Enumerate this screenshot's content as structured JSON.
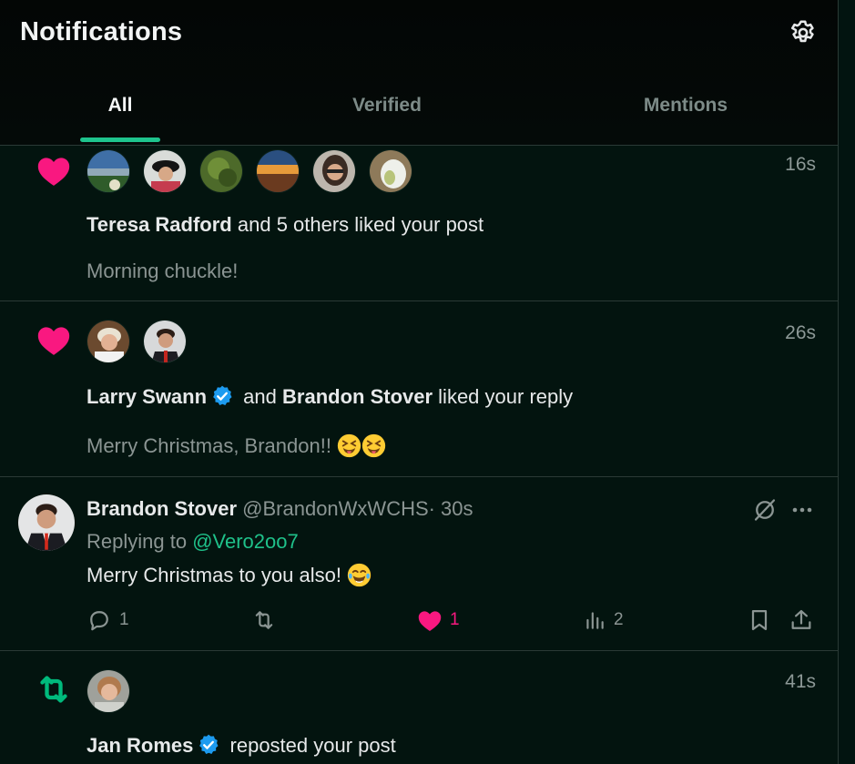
{
  "header": {
    "title": "Notifications",
    "settings_icon": "gear-icon"
  },
  "tabs": [
    {
      "label": "All",
      "active": true
    },
    {
      "label": "Verified",
      "active": false
    },
    {
      "label": "Mentions",
      "active": false
    }
  ],
  "colors": {
    "accent": "#1ec48d",
    "like": "#f91880",
    "verified": "#1d9bf0",
    "repost": "#00ba7c",
    "link": "#1fc18a"
  },
  "notifications": [
    {
      "type": "like",
      "icon": "heart-icon",
      "time": "16s",
      "actor": "Teresa Radford",
      "text": "and 5 others liked your post",
      "snippet": "Morning chuckle!"
    },
    {
      "type": "like",
      "icon": "heart-icon",
      "time": "26s",
      "actor_1": "Larry Swann",
      "joiner": "and",
      "actor_2": "Brandon Stover",
      "text": "liked your reply",
      "snippet": "Merry Christmas, Brandon!!"
    },
    {
      "type": "reply",
      "author_name": "Brandon Stover",
      "author_handle": "@BrandonWxWCHS",
      "separator": "·",
      "time": "30s",
      "replying_prefix": "Replying to",
      "replying_to": "@Vero2oo7",
      "body": "Merry Christmas to you also!",
      "actions": {
        "reply_count": "1",
        "repost_count": "",
        "like_count": "1",
        "views_count": "2"
      }
    },
    {
      "type": "repost",
      "icon": "repost-icon",
      "time": "41s",
      "actor": "Jan Romes",
      "text": "reposted your post"
    }
  ]
}
